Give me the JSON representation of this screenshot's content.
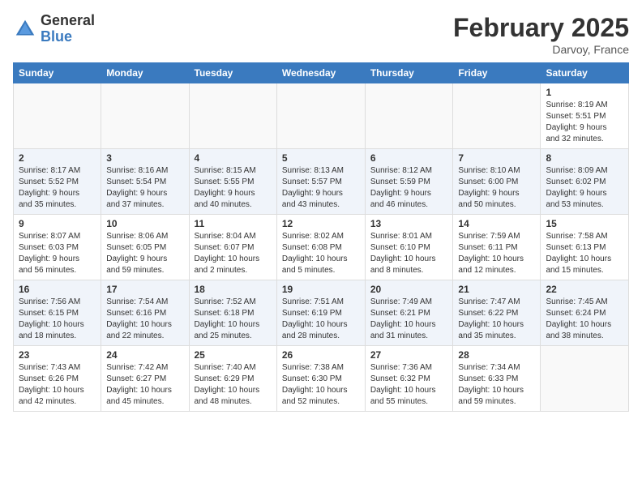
{
  "header": {
    "logo_general": "General",
    "logo_blue": "Blue",
    "month_title": "February 2025",
    "location": "Darvoy, France"
  },
  "weekdays": [
    "Sunday",
    "Monday",
    "Tuesday",
    "Wednesday",
    "Thursday",
    "Friday",
    "Saturday"
  ],
  "weeks": [
    [
      {
        "day": "",
        "info": ""
      },
      {
        "day": "",
        "info": ""
      },
      {
        "day": "",
        "info": ""
      },
      {
        "day": "",
        "info": ""
      },
      {
        "day": "",
        "info": ""
      },
      {
        "day": "",
        "info": ""
      },
      {
        "day": "1",
        "info": "Sunrise: 8:19 AM\nSunset: 5:51 PM\nDaylight: 9 hours\nand 32 minutes."
      }
    ],
    [
      {
        "day": "2",
        "info": "Sunrise: 8:17 AM\nSunset: 5:52 PM\nDaylight: 9 hours\nand 35 minutes."
      },
      {
        "day": "3",
        "info": "Sunrise: 8:16 AM\nSunset: 5:54 PM\nDaylight: 9 hours\nand 37 minutes."
      },
      {
        "day": "4",
        "info": "Sunrise: 8:15 AM\nSunset: 5:55 PM\nDaylight: 9 hours\nand 40 minutes."
      },
      {
        "day": "5",
        "info": "Sunrise: 8:13 AM\nSunset: 5:57 PM\nDaylight: 9 hours\nand 43 minutes."
      },
      {
        "day": "6",
        "info": "Sunrise: 8:12 AM\nSunset: 5:59 PM\nDaylight: 9 hours\nand 46 minutes."
      },
      {
        "day": "7",
        "info": "Sunrise: 8:10 AM\nSunset: 6:00 PM\nDaylight: 9 hours\nand 50 minutes."
      },
      {
        "day": "8",
        "info": "Sunrise: 8:09 AM\nSunset: 6:02 PM\nDaylight: 9 hours\nand 53 minutes."
      }
    ],
    [
      {
        "day": "9",
        "info": "Sunrise: 8:07 AM\nSunset: 6:03 PM\nDaylight: 9 hours\nand 56 minutes."
      },
      {
        "day": "10",
        "info": "Sunrise: 8:06 AM\nSunset: 6:05 PM\nDaylight: 9 hours\nand 59 minutes."
      },
      {
        "day": "11",
        "info": "Sunrise: 8:04 AM\nSunset: 6:07 PM\nDaylight: 10 hours\nand 2 minutes."
      },
      {
        "day": "12",
        "info": "Sunrise: 8:02 AM\nSunset: 6:08 PM\nDaylight: 10 hours\nand 5 minutes."
      },
      {
        "day": "13",
        "info": "Sunrise: 8:01 AM\nSunset: 6:10 PM\nDaylight: 10 hours\nand 8 minutes."
      },
      {
        "day": "14",
        "info": "Sunrise: 7:59 AM\nSunset: 6:11 PM\nDaylight: 10 hours\nand 12 minutes."
      },
      {
        "day": "15",
        "info": "Sunrise: 7:58 AM\nSunset: 6:13 PM\nDaylight: 10 hours\nand 15 minutes."
      }
    ],
    [
      {
        "day": "16",
        "info": "Sunrise: 7:56 AM\nSunset: 6:15 PM\nDaylight: 10 hours\nand 18 minutes."
      },
      {
        "day": "17",
        "info": "Sunrise: 7:54 AM\nSunset: 6:16 PM\nDaylight: 10 hours\nand 22 minutes."
      },
      {
        "day": "18",
        "info": "Sunrise: 7:52 AM\nSunset: 6:18 PM\nDaylight: 10 hours\nand 25 minutes."
      },
      {
        "day": "19",
        "info": "Sunrise: 7:51 AM\nSunset: 6:19 PM\nDaylight: 10 hours\nand 28 minutes."
      },
      {
        "day": "20",
        "info": "Sunrise: 7:49 AM\nSunset: 6:21 PM\nDaylight: 10 hours\nand 31 minutes."
      },
      {
        "day": "21",
        "info": "Sunrise: 7:47 AM\nSunset: 6:22 PM\nDaylight: 10 hours\nand 35 minutes."
      },
      {
        "day": "22",
        "info": "Sunrise: 7:45 AM\nSunset: 6:24 PM\nDaylight: 10 hours\nand 38 minutes."
      }
    ],
    [
      {
        "day": "23",
        "info": "Sunrise: 7:43 AM\nSunset: 6:26 PM\nDaylight: 10 hours\nand 42 minutes."
      },
      {
        "day": "24",
        "info": "Sunrise: 7:42 AM\nSunset: 6:27 PM\nDaylight: 10 hours\nand 45 minutes."
      },
      {
        "day": "25",
        "info": "Sunrise: 7:40 AM\nSunset: 6:29 PM\nDaylight: 10 hours\nand 48 minutes."
      },
      {
        "day": "26",
        "info": "Sunrise: 7:38 AM\nSunset: 6:30 PM\nDaylight: 10 hours\nand 52 minutes."
      },
      {
        "day": "27",
        "info": "Sunrise: 7:36 AM\nSunset: 6:32 PM\nDaylight: 10 hours\nand 55 minutes."
      },
      {
        "day": "28",
        "info": "Sunrise: 7:34 AM\nSunset: 6:33 PM\nDaylight: 10 hours\nand 59 minutes."
      },
      {
        "day": "",
        "info": ""
      }
    ]
  ]
}
